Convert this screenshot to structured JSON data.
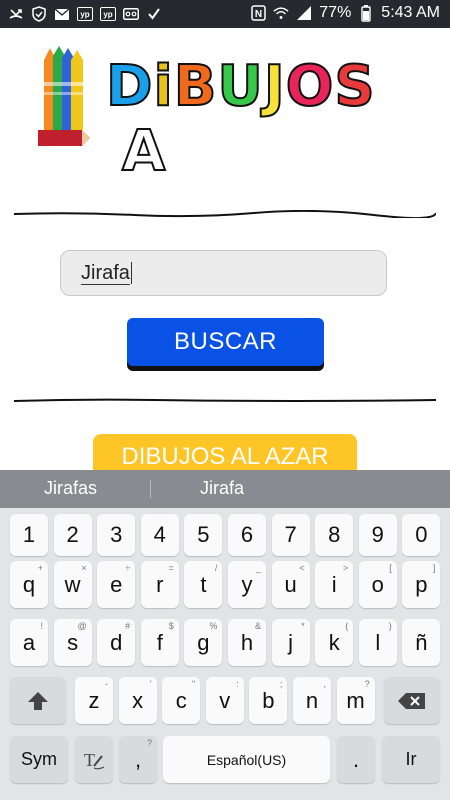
{
  "status_bar": {
    "battery_percent": "77%",
    "time": "5:43 AM",
    "left_icons": [
      "missed-call-icon",
      "shield-icon",
      "mail-icon",
      "yelp-icon",
      "yelp-icon",
      "voicemail-icon",
      "check-icon"
    ],
    "right_icons": [
      "nfc-icon",
      "wifi-icon",
      "signal-icon",
      "battery-icon"
    ]
  },
  "logo": {
    "title": "DiBUJOS",
    "suffix": "A",
    "letter_colors": [
      "#1aa0e8",
      "#e8c21a",
      "#f06a1e",
      "#37c74a",
      "#f5e23a",
      "#e8245a",
      "#e83a3a"
    ]
  },
  "search": {
    "value": "Jirafa"
  },
  "buttons": {
    "buscar": "BUSCAR",
    "azar": "DIBUJOS AL AZAR"
  },
  "keyboard": {
    "suggestions": [
      "Jirafas",
      "Jirafa"
    ],
    "row_numbers": [
      "1",
      "2",
      "3",
      "4",
      "5",
      "6",
      "7",
      "8",
      "9",
      "0"
    ],
    "row1": [
      {
        "k": "q",
        "h": "+"
      },
      {
        "k": "w",
        "h": "×"
      },
      {
        "k": "e",
        "h": "÷"
      },
      {
        "k": "r",
        "h": "="
      },
      {
        "k": "t",
        "h": "/"
      },
      {
        "k": "y",
        "h": "_"
      },
      {
        "k": "u",
        "h": "<"
      },
      {
        "k": "i",
        "h": ">"
      },
      {
        "k": "o",
        "h": "["
      },
      {
        "k": "p",
        "h": "]"
      }
    ],
    "row2": [
      {
        "k": "a",
        "h": "!"
      },
      {
        "k": "s",
        "h": "@"
      },
      {
        "k": "d",
        "h": "#"
      },
      {
        "k": "f",
        "h": "$"
      },
      {
        "k": "g",
        "h": "%"
      },
      {
        "k": "h",
        "h": "&"
      },
      {
        "k": "j",
        "h": "*"
      },
      {
        "k": "k",
        "h": "("
      },
      {
        "k": "l",
        "h": ")"
      },
      {
        "k": "ñ",
        "h": ""
      }
    ],
    "row3": [
      {
        "k": "z",
        "h": "-"
      },
      {
        "k": "x",
        "h": "'"
      },
      {
        "k": "c",
        "h": "\""
      },
      {
        "k": "v",
        "h": ":"
      },
      {
        "k": "b",
        "h": ";"
      },
      {
        "k": "n",
        "h": ","
      },
      {
        "k": "m",
        "h": "?"
      }
    ],
    "sym": "Sym",
    "comma": ",",
    "comma_hint": "?",
    "space": "Español(US)",
    "period": ".",
    "go": "Ir"
  }
}
